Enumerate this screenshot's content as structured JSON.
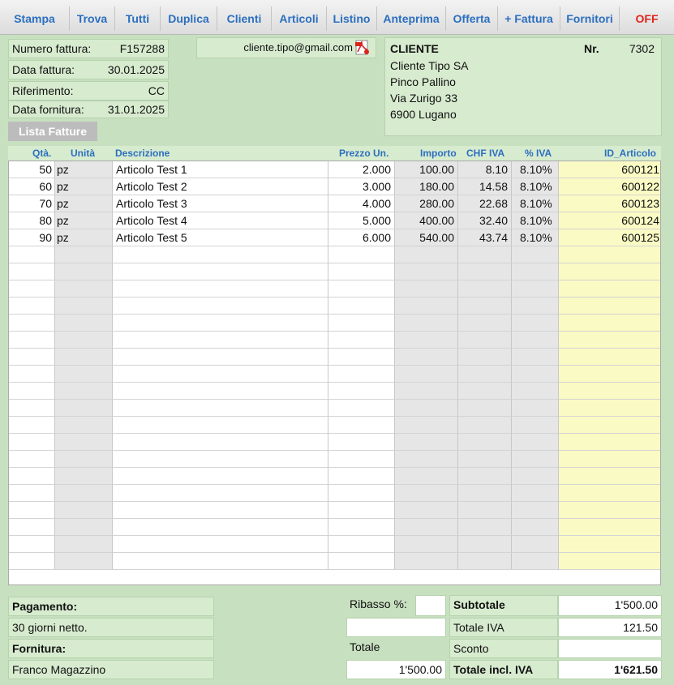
{
  "toolbar": {
    "buttons": [
      "Stampa",
      "Trova",
      "Tutti",
      "Duplica",
      "Clienti",
      "Articoli",
      "Listino",
      "Anteprima",
      "Offerta",
      "+ Fattura",
      "Fornitori",
      "OFF"
    ]
  },
  "invoice": {
    "numero_label": "Numero fattura:",
    "numero_value": "F157288",
    "data_label": "Data fattura:",
    "data_value": "30.01.2025",
    "rif_label": "Riferimento:",
    "rif_value": "CC",
    "fornitura_label": "Data fornitura:",
    "fornitura_value": "31.01.2025",
    "email": "cliente.tipo@gmail.com",
    "lista_button": "Lista Fatture"
  },
  "client": {
    "heading": "CLIENTE",
    "nr_label": "Nr.",
    "nr_value": "7302",
    "name": "Cliente Tipo SA",
    "contact": "Pinco Pallino",
    "street": "Via Zurigo 33",
    "city": "6900 Lugano"
  },
  "table": {
    "headers": {
      "qta": "Qtà.",
      "unita": "Unità",
      "desc": "Descrizione",
      "prezzo": "Prezzo Un.",
      "importo": "Importo",
      "chf_iva": "CHF  IVA",
      "pct_iva": "% IVA",
      "id": "ID_Articolo"
    },
    "rows": [
      {
        "qta": "50",
        "unita": "pz",
        "desc": "Articolo Test 1",
        "prezzo": "2.000",
        "importo": "100.00",
        "chf_iva": "8.10",
        "pct_iva": "8.10%",
        "id": "600121"
      },
      {
        "qta": "60",
        "unita": "pz",
        "desc": "Articolo Test 2",
        "prezzo": "3.000",
        "importo": "180.00",
        "chf_iva": "14.58",
        "pct_iva": "8.10%",
        "id": "600122"
      },
      {
        "qta": "70",
        "unita": "pz",
        "desc": "Articolo Test 3",
        "prezzo": "4.000",
        "importo": "280.00",
        "chf_iva": "22.68",
        "pct_iva": "8.10%",
        "id": "600123"
      },
      {
        "qta": "80",
        "unita": "pz",
        "desc": "Articolo Test 4",
        "prezzo": "5.000",
        "importo": "400.00",
        "chf_iva": "32.40",
        "pct_iva": "8.10%",
        "id": "600124"
      },
      {
        "qta": "90",
        "unita": "pz",
        "desc": "Articolo Test 5",
        "prezzo": "6.000",
        "importo": "540.00",
        "chf_iva": "43.74",
        "pct_iva": "8.10%",
        "id": "600125"
      }
    ]
  },
  "footer": {
    "pagamento_label": "Pagamento:",
    "pagamento_value": "30 giorni netto.",
    "fornitura_label": "Fornitura:",
    "fornitura_value": "Franco Magazzino",
    "ribasso_label": "Ribasso %:",
    "ribasso_value": "",
    "totale_label": "Totale",
    "totale_value": "1'500.00",
    "subtotale_label": "Subtotale",
    "subtotale_value": "1'500.00",
    "totale_iva_label": "Totale IVA",
    "totale_iva_value": "121.50",
    "sconto_label": "Sconto",
    "sconto_value": "",
    "totale_incl_label": "Totale incl. IVA",
    "totale_incl_value": "1'621.50"
  },
  "colors": {
    "background": "#c7e0bf",
    "accent": "#2b6fc0",
    "off": "#e0241b",
    "id_column": "#fafac4"
  },
  "icons": {
    "email_attachment": "pdf-icon"
  }
}
